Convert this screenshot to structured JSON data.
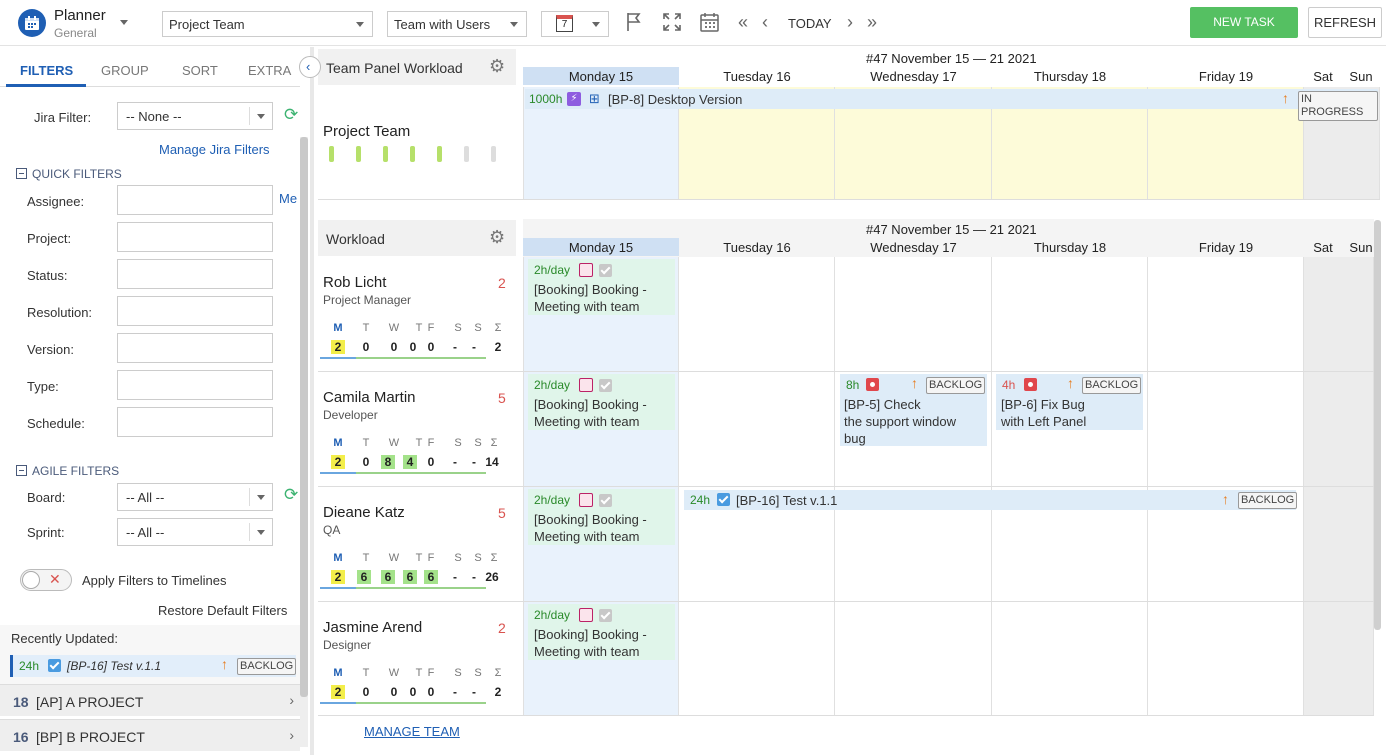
{
  "app": {
    "title": "Planner",
    "subtitle": "General"
  },
  "toolbar": {
    "team_select": "Project Team",
    "view_select": "Team with Users",
    "days_value": "7",
    "today": "TODAY",
    "new_task": "NEW TASK",
    "refresh": "REFRESH"
  },
  "left": {
    "tabs": [
      "FILTERS",
      "GROUP",
      "SORT",
      "EXTRA"
    ],
    "jira_filter_label": "Jira Filter:",
    "jira_filter_value": "-- None --",
    "manage_jira_filters": "Manage Jira Filters",
    "quick_filters_title": "QUICK FILTERS",
    "quick_filters": [
      "Assignee:",
      "Project:",
      "Status:",
      "Resolution:",
      "Version:",
      "Type:",
      "Schedule:"
    ],
    "me_link": "Me",
    "agile_filters_title": "AGILE FILTERS",
    "board_label": "Board:",
    "board_value": "-- All --",
    "sprint_label": "Sprint:",
    "sprint_value": "-- All --",
    "apply_filters": "Apply Filters to Timelines",
    "restore_defaults": "Restore Default Filters",
    "recently_updated": "Recently Updated:",
    "recent_item": {
      "hours": "24h",
      "title": "[BP-16] Test v.1.1",
      "status": "BACKLOG"
    },
    "projects": [
      {
        "count": "18",
        "name": "[AP] A PROJECT"
      },
      {
        "count": "16",
        "name": "[BP] B PROJECT"
      }
    ]
  },
  "team_panel": {
    "title": "Team Panel Workload",
    "team_name": "Project Team",
    "week_title": "#47 November 15 — 21 2021",
    "days": [
      "Monday 15",
      "Tuesday 16",
      "Wednesday 17",
      "Thursday 18",
      "Friday 19",
      "Sat",
      "Sun"
    ],
    "task": {
      "hours": "1000h",
      "title": "[BP-8] Desktop Version",
      "status": "IN PROGRESS"
    }
  },
  "workload": {
    "title": "Workload",
    "week_title": "#47 November 15 — 21 2021",
    "days": [
      "Monday 15",
      "Tuesday 16",
      "Wednesday 17",
      "Thursday 18",
      "Friday 19",
      "Sat",
      "Sun"
    ],
    "week_letters": [
      "M",
      "T",
      "W",
      "T",
      "F",
      "S",
      "S",
      "Σ"
    ],
    "booking": {
      "rate": "2h/day",
      "text1": "[Booking] Booking -",
      "text2": "Meeting with team"
    },
    "users": [
      {
        "name": "Rob Licht",
        "role": "Project Manager",
        "count": "2",
        "vals": [
          "2",
          "0",
          "0",
          "0",
          "0",
          "-",
          "-",
          "2"
        ]
      },
      {
        "name": "Camila Martin",
        "role": "Developer",
        "count": "5",
        "vals": [
          "2",
          "0",
          "8",
          "4",
          "0",
          "-",
          "-",
          "14"
        ]
      },
      {
        "name": "Dieane Katz",
        "role": "QA",
        "count": "5",
        "vals": [
          "2",
          "6",
          "6",
          "6",
          "6",
          "-",
          "-",
          "26"
        ]
      },
      {
        "name": "Jasmine Arend",
        "role": "Designer",
        "count": "2",
        "vals": [
          "2",
          "0",
          "0",
          "0",
          "0",
          "-",
          "-",
          "2"
        ]
      }
    ],
    "tasks": {
      "bp5": {
        "hours": "8h",
        "status": "BACKLOG",
        "l1": "[BP-5] Check",
        "l2": "the support window",
        "l3": "bug"
      },
      "bp6": {
        "hours": "4h",
        "status": "BACKLOG",
        "l1": "[BP-6] Fix Bug",
        "l2": "with Left Panel"
      },
      "bp16": {
        "hours": "24h",
        "title": "[BP-16] Test v.1.1",
        "status": "BACKLOG"
      }
    },
    "manage_team": "MANAGE TEAM"
  }
}
